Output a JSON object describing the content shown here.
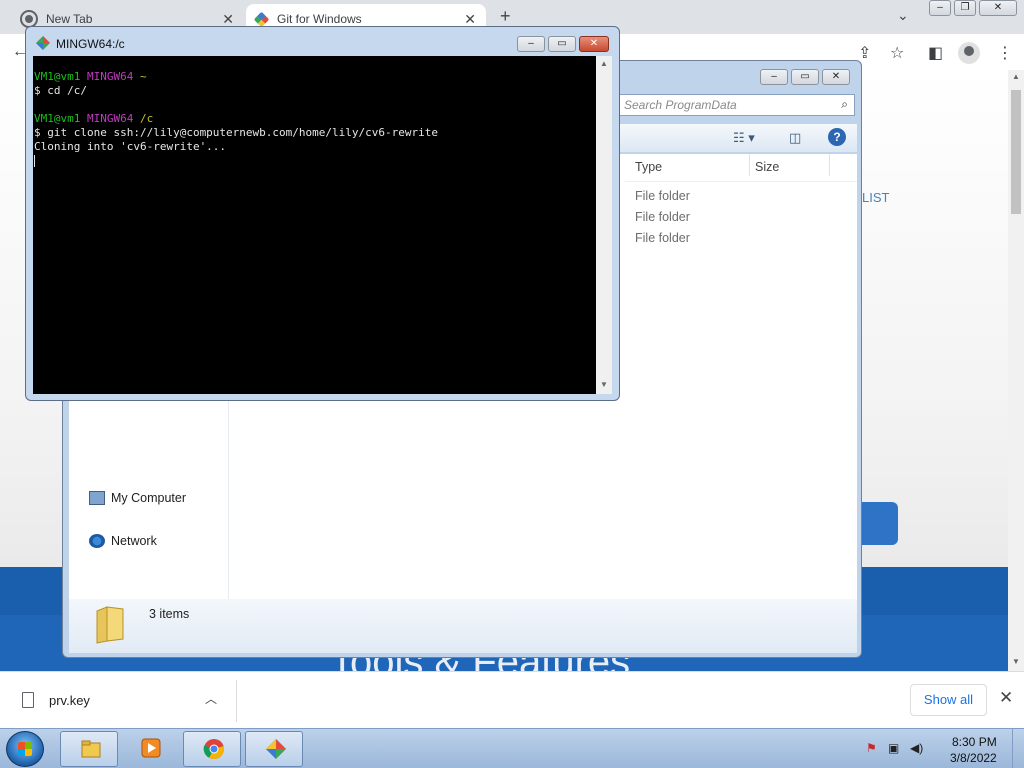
{
  "browser": {
    "tabs": [
      {
        "label": "New Tab",
        "icon": "chrome-newtab-icon"
      },
      {
        "label": "Git for Windows",
        "icon": "git-icon"
      }
    ],
    "new_tab_glyph": "+",
    "tab_close_glyph": "✕",
    "dropdown_glyph": "⌄",
    "toolbar_icons": [
      "share-icon",
      "star-icon",
      "side-panel-icon",
      "profile-icon",
      "menu-icon"
    ]
  },
  "webpage": {
    "list_link": "LIST",
    "band_heading": "Tools & Features"
  },
  "explorer": {
    "search_placeholder": "Search ProgramData",
    "columns": {
      "type": "Type",
      "size": "Size"
    },
    "rows": [
      {
        "type": "File folder"
      },
      {
        "type": "File folder"
      },
      {
        "type": "File folder"
      }
    ],
    "nav": {
      "my_computer": "My Computer",
      "network": "Network"
    },
    "status": "3 items"
  },
  "terminal": {
    "title": "MINGW64:/c",
    "lines": [
      {
        "user": "VM1@vm1",
        "shell": "MINGW64",
        "path": "~"
      },
      {
        "cmd": "$ cd /c/"
      },
      {
        "user": "VM1@vm1",
        "shell": "MINGW64",
        "path": "/c"
      },
      {
        "cmd": "$ git clone ssh://lily@computernewb.com/home/lily/cv6-rewrite"
      },
      {
        "out": "Cloning into 'cv6-rewrite'..."
      }
    ]
  },
  "downloads": {
    "file_name": "prv.key",
    "show_all": "Show all",
    "close_glyph": "✕"
  },
  "taskbar": {
    "time": "8:30 PM",
    "date": "3/8/2022",
    "buttons": [
      "explorer-icon",
      "media-player-icon",
      "chrome-icon",
      "git-icon"
    ]
  },
  "colors": {
    "terminal_user": "#19c219",
    "terminal_shell": "#c23ac2",
    "terminal_path": "#c8c21d",
    "page_band": "#1f66b8"
  }
}
